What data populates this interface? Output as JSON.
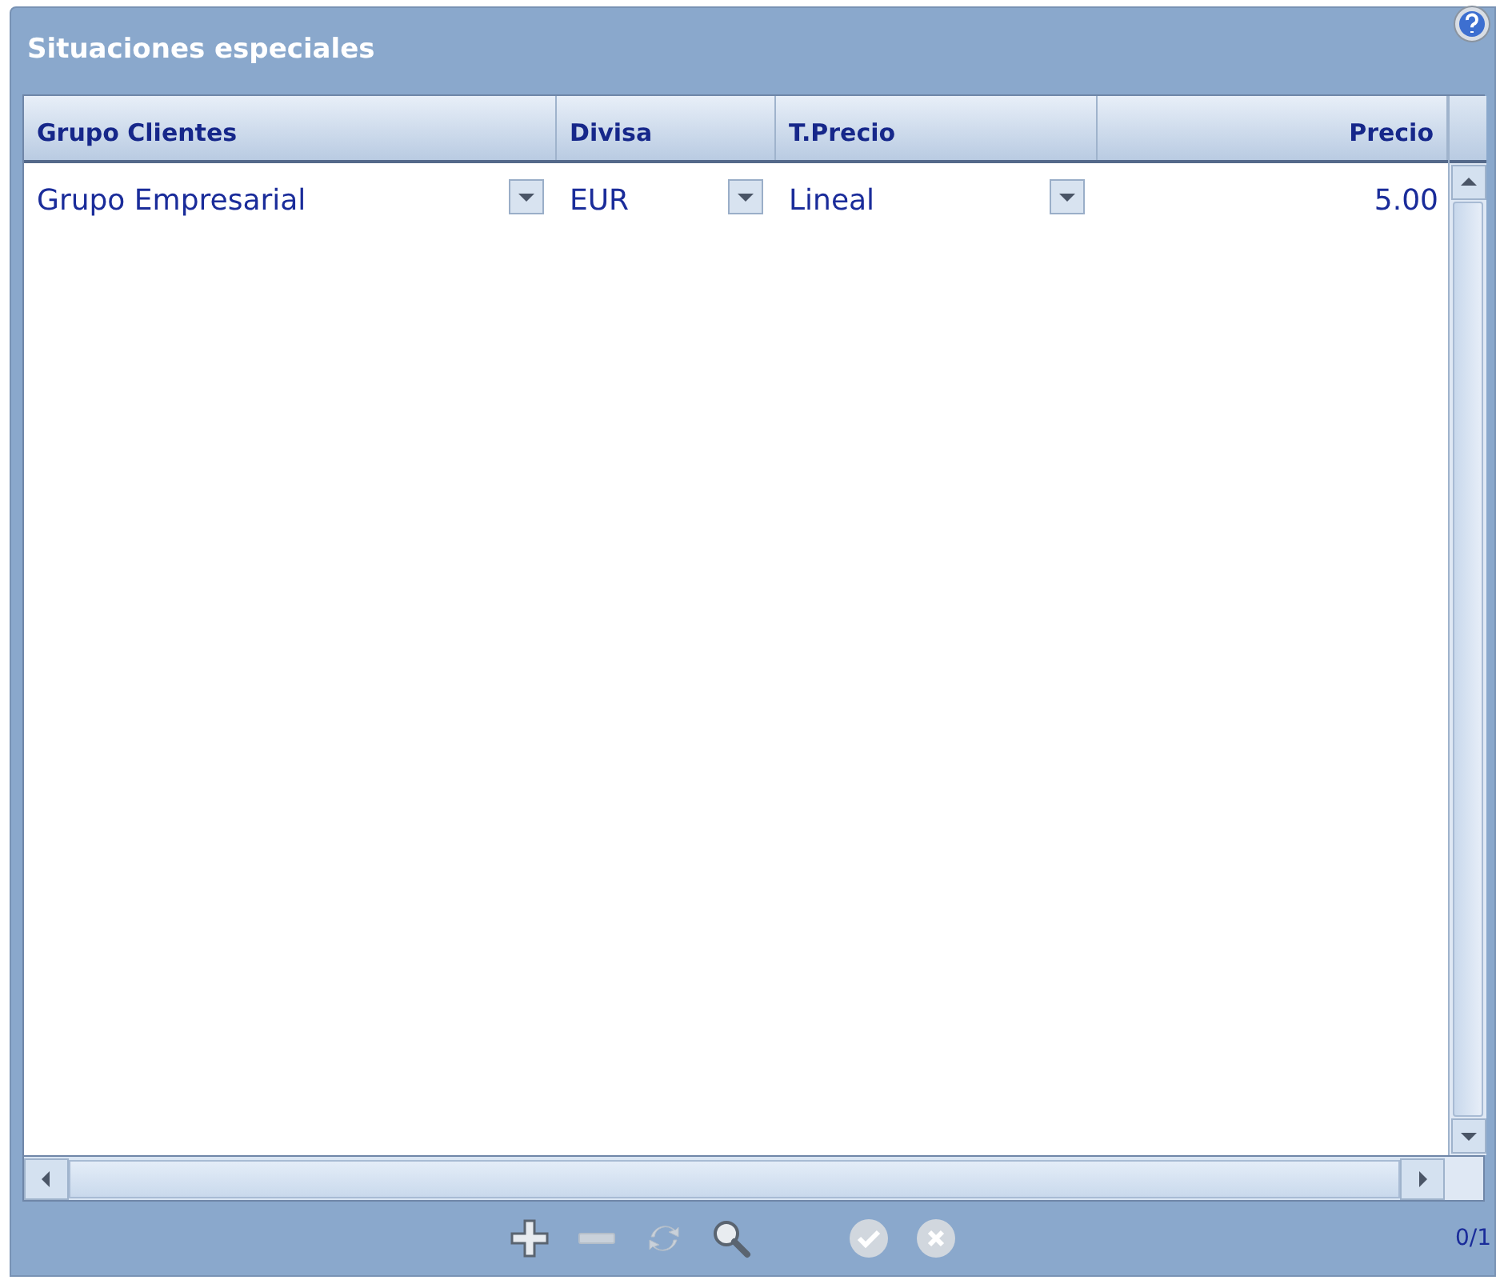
{
  "window": {
    "title": "Situaciones especiales"
  },
  "table": {
    "columns": [
      "Grupo Clientes",
      "Divisa",
      "T.Precio",
      "Precio"
    ],
    "rows": [
      [
        {
          "text": "Grupo Empresarial",
          "kind": "dropdown"
        },
        {
          "text": "EUR",
          "kind": "dropdown"
        },
        {
          "text": "Lineal",
          "kind": "dropdown"
        },
        {
          "text": "5.00",
          "kind": "number"
        }
      ]
    ]
  },
  "toolbar": [
    {
      "kind": "add",
      "disabled": false
    },
    {
      "kind": "remove",
      "disabled": true
    },
    {
      "kind": "refresh",
      "disabled": true
    },
    {
      "kind": "search",
      "disabled": false
    },
    {
      "kind": "gap"
    },
    {
      "kind": "confirm",
      "disabled": true
    },
    {
      "kind": "cancel",
      "disabled": true
    }
  ],
  "status": {
    "counter": "0/1"
  }
}
